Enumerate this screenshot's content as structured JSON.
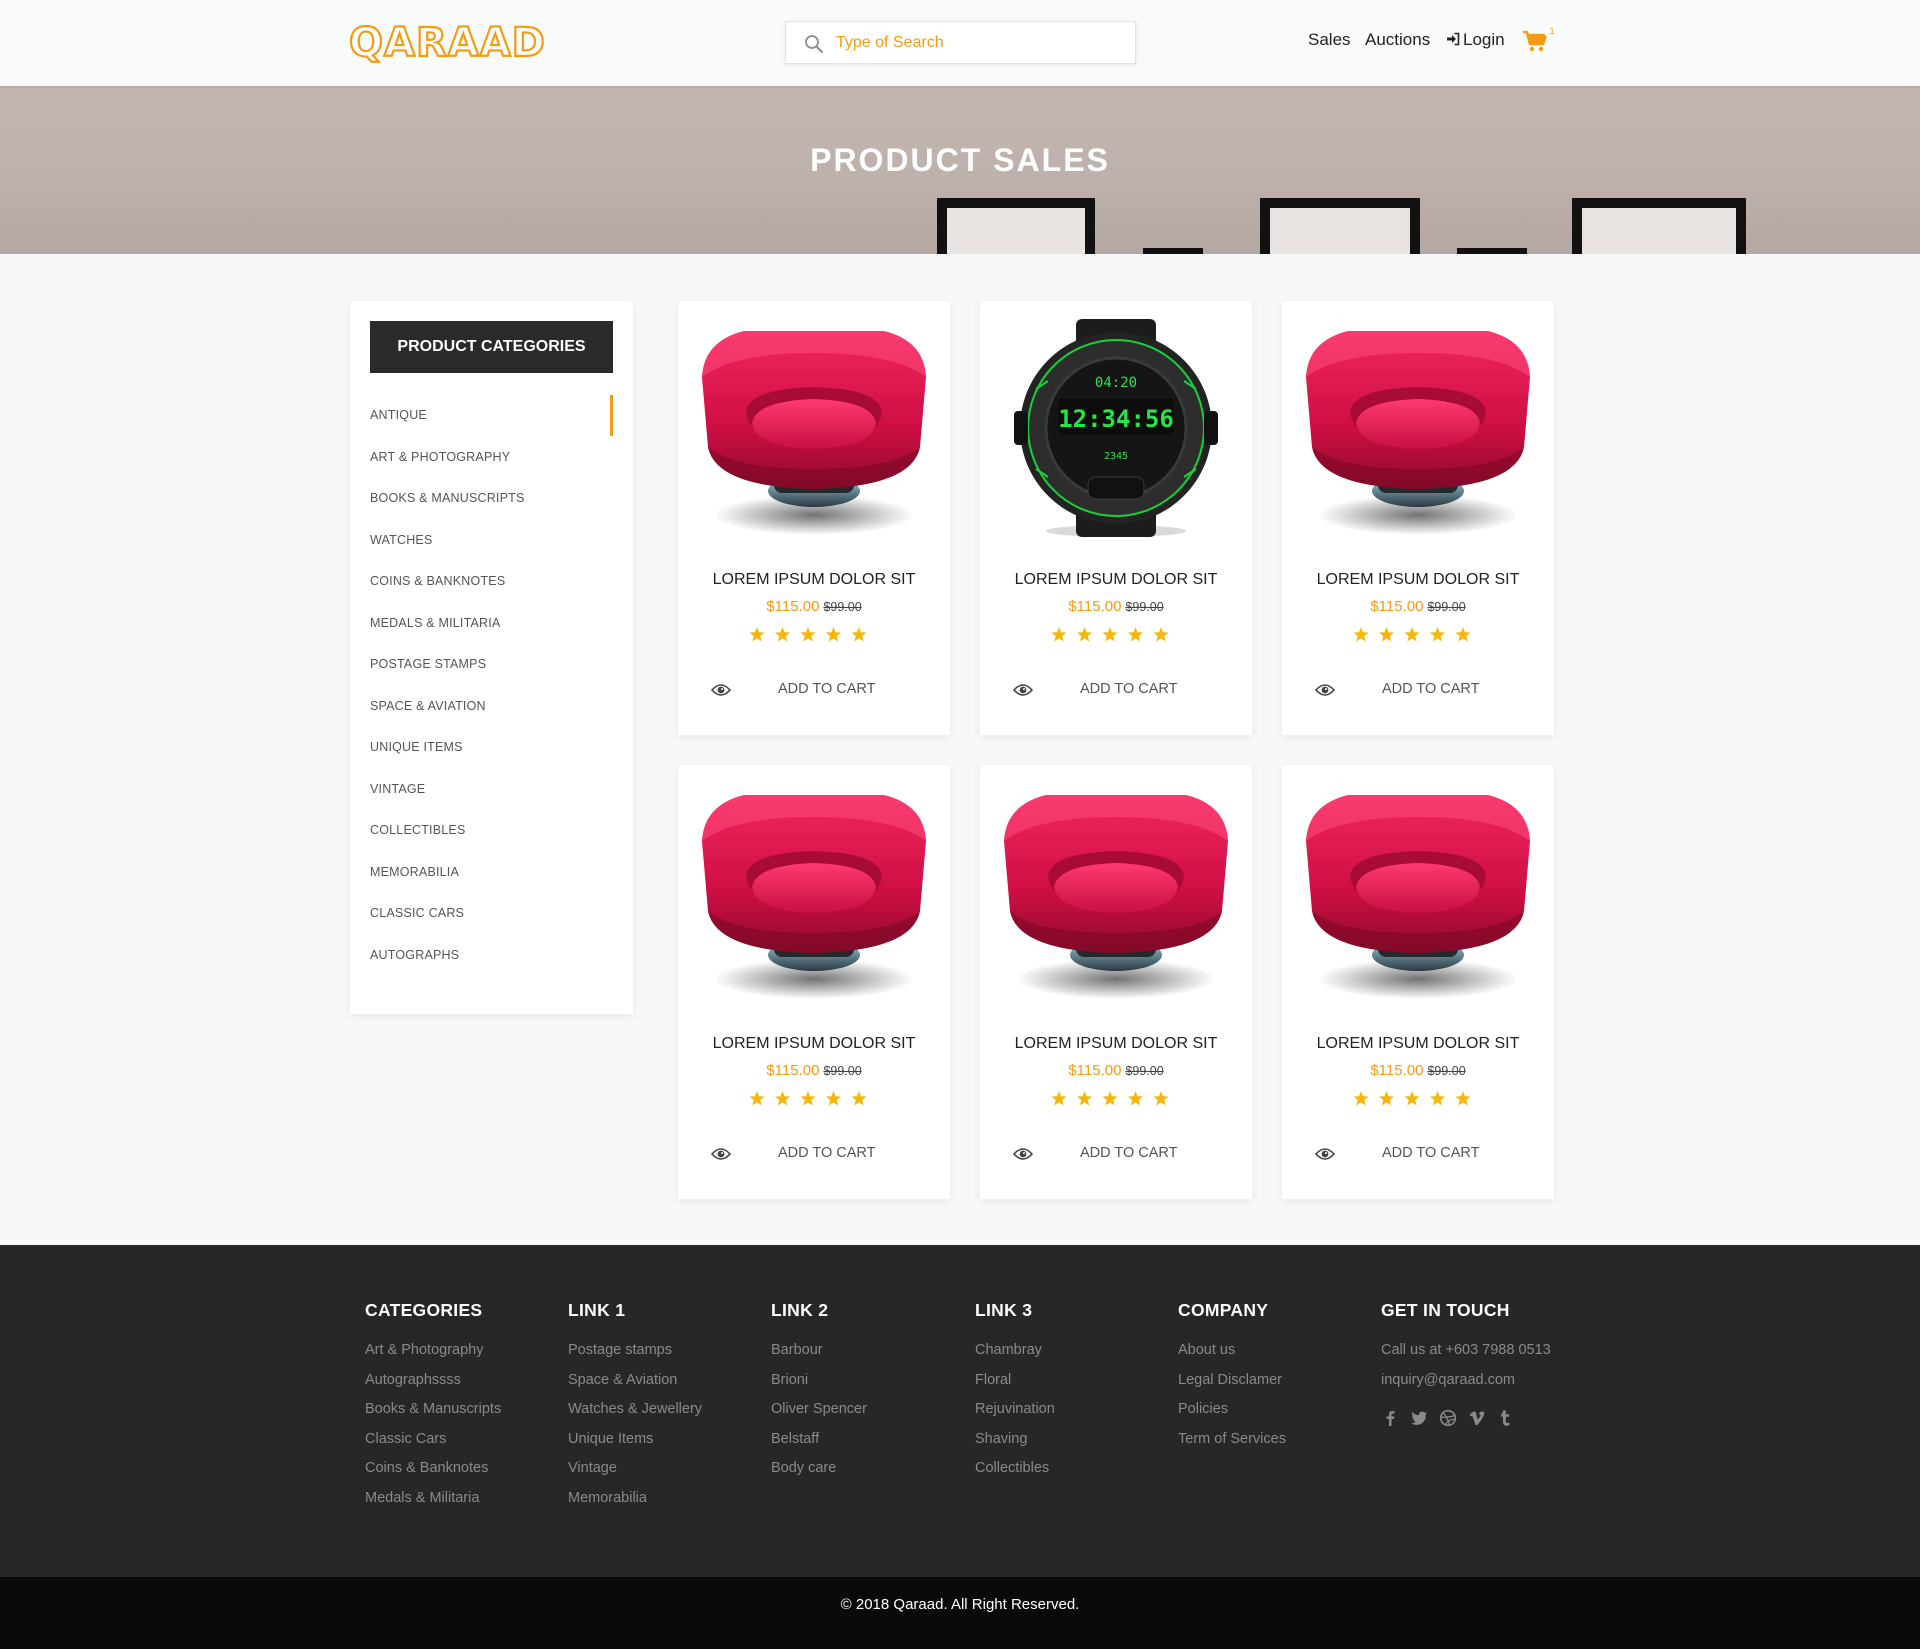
{
  "header": {
    "logo": "QARAAD",
    "search_placeholder": "Type of Search",
    "nav": {
      "sales": "Sales",
      "auctions": "Auctions",
      "login": "Login"
    },
    "cart_count": "1"
  },
  "banner": {
    "title": "PRODUCT SALES"
  },
  "sidebar": {
    "title": "PRODUCT CATEGORIES",
    "items": [
      "ANTIQUE",
      "ART & PHOTOGRAPHY",
      "BOOKS & MANUSCRIPTS",
      "WATCHES",
      "COINS & BANKNOTES",
      "MEDALS & MILITARIA",
      "POSTAGE STAMPS",
      "SPACE & AVIATION",
      "UNIQUE ITEMS",
      "VINTAGE",
      "COLLECTIBLES",
      "MEMORABILIA",
      "CLASSIC CARS",
      "AUTOGRAPHS"
    ],
    "active_index": 0
  },
  "products": [
    {
      "title": "LOREM IPSUM DOLOR SIT",
      "price": "$115.00",
      "old_price": "$99.00",
      "rating": 5,
      "image": "red-chair",
      "cart_label": "ADD TO CART"
    },
    {
      "title": "LOREM IPSUM DOLOR SIT",
      "price": "$115.00",
      "old_price": "$99.00",
      "rating": 5,
      "image": "watch",
      "cart_label": "ADD TO CART"
    },
    {
      "title": "LOREM IPSUM DOLOR SIT",
      "price": "$115.00",
      "old_price": "$99.00",
      "rating": 5,
      "image": "red-chair",
      "cart_label": "ADD TO CART"
    },
    {
      "title": "LOREM IPSUM DOLOR SIT",
      "price": "$115.00",
      "old_price": "$99.00",
      "rating": 5,
      "image": "red-chair",
      "cart_label": "ADD TO CART"
    },
    {
      "title": "LOREM IPSUM DOLOR SIT",
      "price": "$115.00",
      "old_price": "$99.00",
      "rating": 5,
      "image": "red-chair",
      "cart_label": "ADD TO CART"
    },
    {
      "title": "LOREM IPSUM DOLOR SIT",
      "price": "$115.00",
      "old_price": "$99.00",
      "rating": 5,
      "image": "red-chair",
      "cart_label": "ADD TO CART"
    }
  ],
  "watch_display": {
    "top": "04:20",
    "main": "12:34:56",
    "bottom": "2345"
  },
  "footer": {
    "columns": [
      {
        "title": "CATEGORIES",
        "links": [
          "Art & Photography",
          "Autographssss",
          "Books & Manuscripts",
          "Classic Cars",
          "Coins & Banknotes",
          "Medals & Militaria"
        ]
      },
      {
        "title": "LINK 1",
        "links": [
          "Postage stamps",
          "Space & Aviation",
          "Watches & Jewellery",
          "Unique Items",
          "Vintage",
          "Memorabilia"
        ]
      },
      {
        "title": "LINK 2",
        "links": [
          "Barbour",
          "Brioni",
          "Oliver Spencer",
          "Belstaff",
          "Body care"
        ]
      },
      {
        "title": "LINK 3",
        "links": [
          "Chambray",
          "Floral",
          "Rejuvination",
          "Shaving",
          "Collectibles"
        ]
      },
      {
        "title": "COMPANY",
        "links": [
          "About us",
          "Legal Disclamer",
          "Policies",
          "Term of Services"
        ]
      },
      {
        "title": "GET IN TOUCH",
        "links": [
          "Call us at +603 7988 0513",
          "inquiry@qaraad.com"
        ]
      }
    ],
    "social": [
      "facebook-icon",
      "twitter-icon",
      "dribbble-icon",
      "vimeo-icon",
      "tumblr-icon"
    ],
    "copyright": "© 2018 Qaraad. All Right Reserved."
  },
  "colors": {
    "accent": "#f39c12",
    "dark": "#272727",
    "footer_bottom": "#0a0a0a"
  }
}
